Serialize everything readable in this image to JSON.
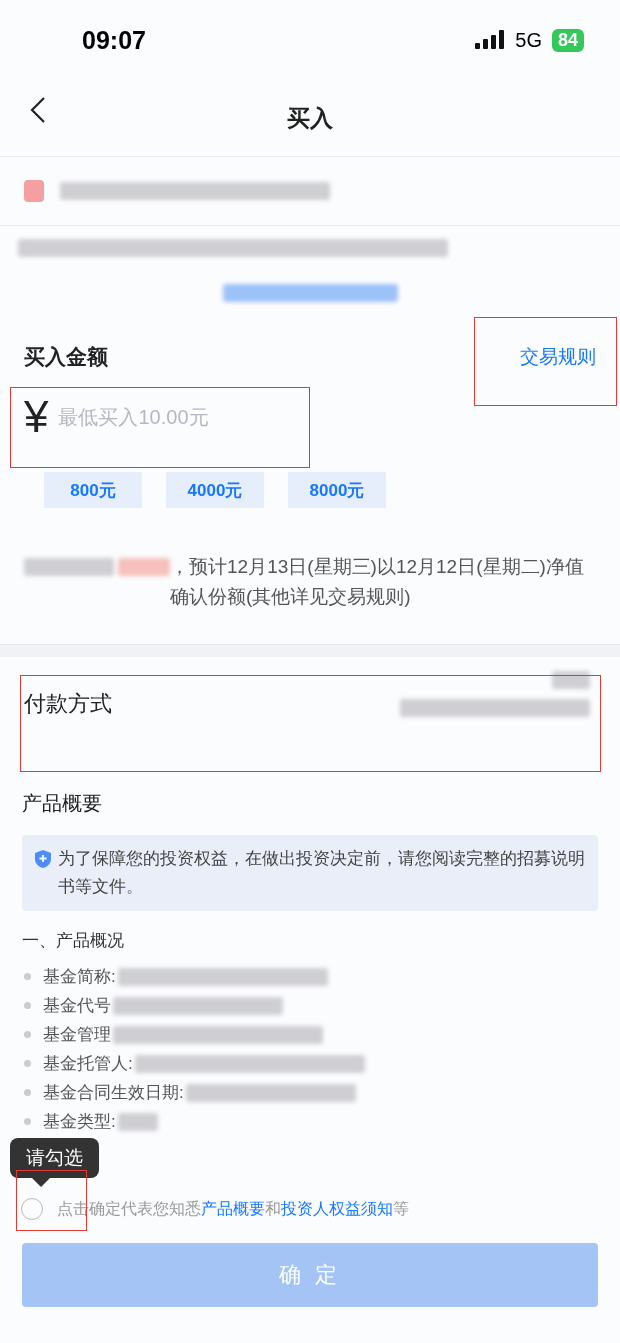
{
  "status_bar": {
    "time": "09:07",
    "network": "5G",
    "battery": "84"
  },
  "nav": {
    "title": "买入"
  },
  "amount": {
    "label": "买入金额",
    "rules_link": "交易规则",
    "currency": "¥",
    "placeholder": "最低买入10.00元"
  },
  "quick_amounts": [
    "800元",
    "4000元",
    "8000元"
  ],
  "confirm_note": "，预计12月13日(星期三)以12月12日(星期二)净值确认份额(其他详见交易规则)",
  "payment": {
    "label": "付款方式"
  },
  "overview": {
    "title": "产品概要",
    "notice": "为了保障您的投资权益，在做出投资决定前，请您阅读完整的招募说明书等文件。",
    "section": "一、产品概况",
    "items": [
      "基金简称:",
      "基金代号",
      "基金管理",
      "基金托管人:",
      "基金合同生效日期:",
      "基金类型:"
    ]
  },
  "agreement": {
    "checked": false,
    "text_before": "点击确定代表您知悉",
    "link_1": "产品概要",
    "middle": "和",
    "link_2": "投资人权益须知",
    "text_after": "等",
    "tooltip": "请勾选"
  },
  "confirm_button": {
    "label": "确 定",
    "disabled": true
  }
}
